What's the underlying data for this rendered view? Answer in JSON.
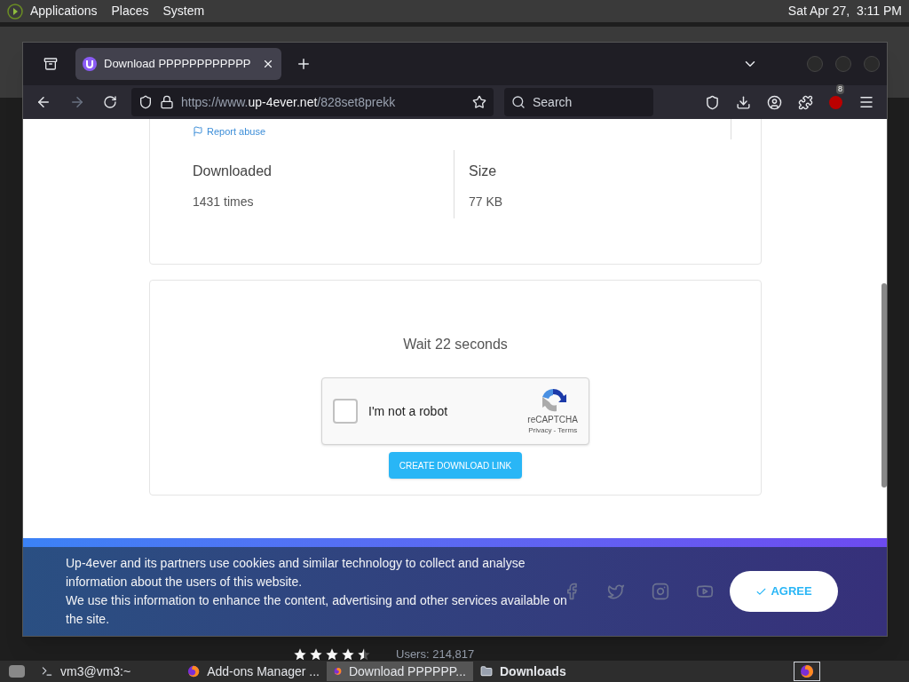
{
  "top_panel": {
    "menus": [
      "Applications",
      "Places",
      "System"
    ],
    "clock": "Sat Apr 27,  3:11 PM"
  },
  "browser": {
    "tab": {
      "title": "Download PPPPPPPPPPPP",
      "selected": true
    },
    "url": {
      "prefix": "https://www.",
      "domain": "up-4ever.net",
      "path": "/828set8prekk"
    },
    "search": {
      "placeholder": "Search"
    },
    "extension_badge": "8"
  },
  "page": {
    "report_abuse": "Report abuse",
    "stats": [
      {
        "label": "Downloaded",
        "value": "1431 times"
      },
      {
        "label": "Size",
        "value": "77 KB"
      }
    ],
    "wait": "Wait 22 seconds",
    "captcha": {
      "label": "I'm not a robot",
      "checked": false,
      "brand": "reCAPTCHA",
      "links": "Privacy - Terms"
    },
    "button": "CREATE DOWNLOAD LINK"
  },
  "cookie_banner": {
    "paragraphs": [
      "Up-4ever and its partners use cookies and similar technology to collect and analyse information about the users of this website.",
      "We use this information to enhance the content, advertising and other services available on the site."
    ],
    "agree": "AGREE"
  },
  "rating": {
    "stars": 4.5,
    "users": "Users: 214,817"
  },
  "taskbar": [
    {
      "kind": "terminal",
      "label": "vm3@vm3:~",
      "selected": false,
      "urgent": false
    },
    {
      "kind": "browser",
      "label": "Add-ons Manager ...",
      "selected": false,
      "urgent": false
    },
    {
      "kind": "browser",
      "label": "Download PPPPPP...",
      "selected": true,
      "urgent": false
    },
    {
      "kind": "folder",
      "label": "Downloads",
      "selected": false,
      "urgent": true
    }
  ]
}
